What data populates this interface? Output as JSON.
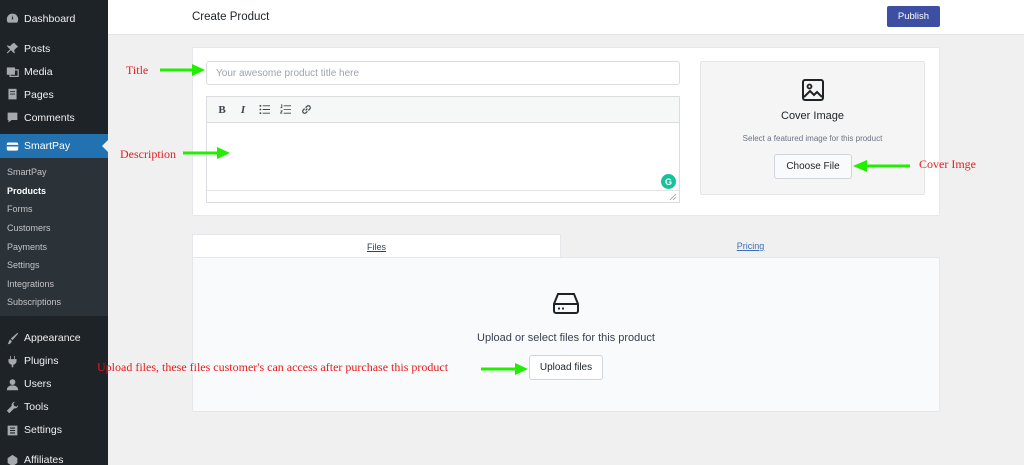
{
  "sidebar": {
    "items_top": [
      {
        "label": "Dashboard",
        "icon": "dashboard-icon"
      },
      {
        "label": "Posts",
        "icon": "pin-icon"
      },
      {
        "label": "Media",
        "icon": "media-icon"
      },
      {
        "label": "Pages",
        "icon": "pages-icon"
      },
      {
        "label": "Comments",
        "icon": "comment-icon"
      }
    ],
    "active": {
      "label": "SmartPay",
      "icon": "smartpay-icon"
    },
    "submenu": [
      "SmartPay",
      "Products",
      "Forms",
      "Customers",
      "Payments",
      "Settings",
      "Integrations",
      "Subscriptions"
    ],
    "items_bottom": [
      {
        "label": "Appearance",
        "icon": "brush-icon"
      },
      {
        "label": "Plugins",
        "icon": "plug-icon"
      },
      {
        "label": "Users",
        "icon": "user-icon"
      },
      {
        "label": "Tools",
        "icon": "wrench-icon"
      },
      {
        "label": "Settings",
        "icon": "settings-icon"
      },
      {
        "label": "Affiliates",
        "icon": "affiliates-icon"
      }
    ]
  },
  "header": {
    "title": "Create Product",
    "publish_label": "Publish"
  },
  "product": {
    "title_placeholder": "Your awesome product title here",
    "title_value": ""
  },
  "editor": {
    "bold": "B",
    "italic": "I",
    "grammarly": "G"
  },
  "cover": {
    "title": "Cover Image",
    "subtitle": "Select a featured image for this product",
    "button": "Choose File"
  },
  "tabs": {
    "files": "Files",
    "pricing": "Pricing"
  },
  "files": {
    "title": "Upload or select files for this product",
    "button": "Upload files"
  },
  "annotations": {
    "title": "Title",
    "description": "Description",
    "cover": "Cover Imge",
    "upload": "Upload files, these files customer's can access after purchase this product"
  },
  "colors": {
    "accent": "#2271b1",
    "publish": "#3c4fa3",
    "annotation_text": "#e31e1e",
    "annotation_arrow": "#22ee00",
    "grammarly": "#15c39a"
  }
}
